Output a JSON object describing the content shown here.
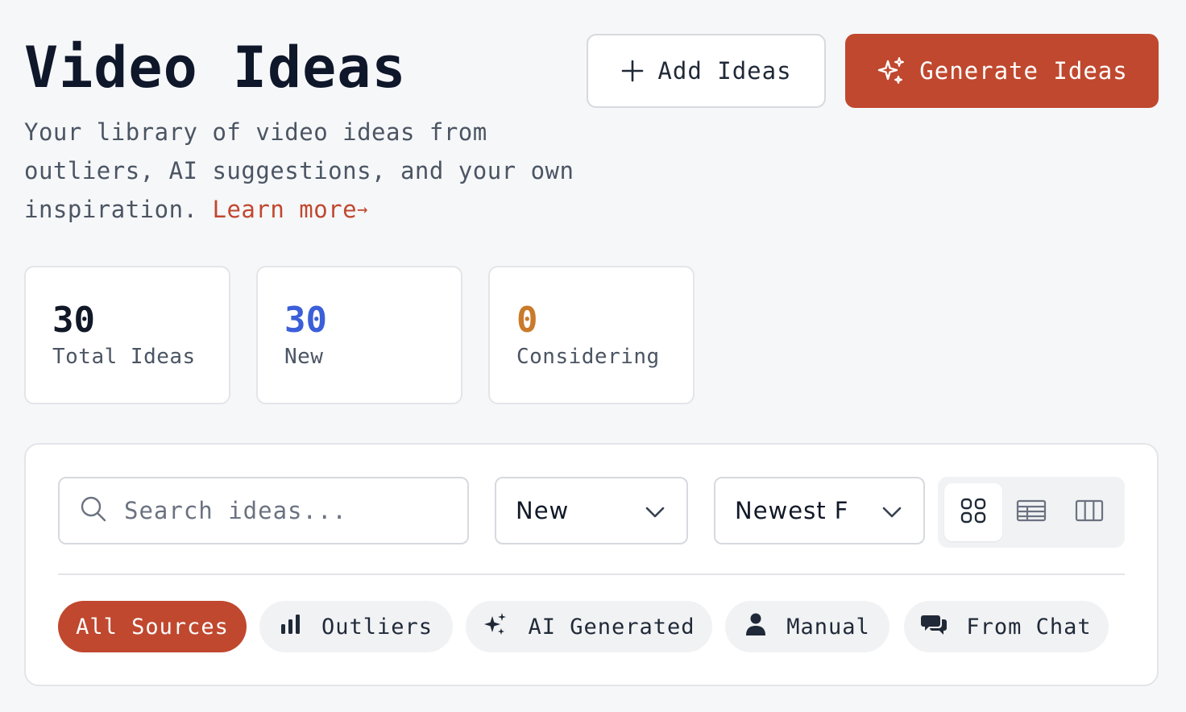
{
  "header": {
    "title": "Video Ideas",
    "subtitle": "Your library of video ideas from outliers, AI suggestions, and your own inspiration.",
    "learn_more": "Learn more",
    "learn_more_arrow": "→"
  },
  "actions": {
    "add_label": "Add Ideas",
    "generate_label": "Generate Ideas"
  },
  "stats": [
    {
      "value": "30",
      "label": "Total Ideas",
      "color": "#111827"
    },
    {
      "value": "30",
      "label": "New",
      "color": "#3b5fd9"
    },
    {
      "value": "0",
      "label": "Considering",
      "color": "#c97a2a"
    }
  ],
  "filters": {
    "search_placeholder": "Search ideas...",
    "status_value": "New",
    "sort_value": "Newest F"
  },
  "sources": [
    {
      "label": "All Sources",
      "icon": "none",
      "active": true
    },
    {
      "label": "Outliers",
      "icon": "bar-chart-icon",
      "active": false
    },
    {
      "label": "AI Generated",
      "icon": "sparkles-icon",
      "active": false
    },
    {
      "label": "Manual",
      "icon": "user-icon",
      "active": false
    },
    {
      "label": "From Chat",
      "icon": "chat-icon",
      "active": false
    }
  ],
  "colors": {
    "accent": "#c0482f",
    "background": "#f6f7f9"
  }
}
